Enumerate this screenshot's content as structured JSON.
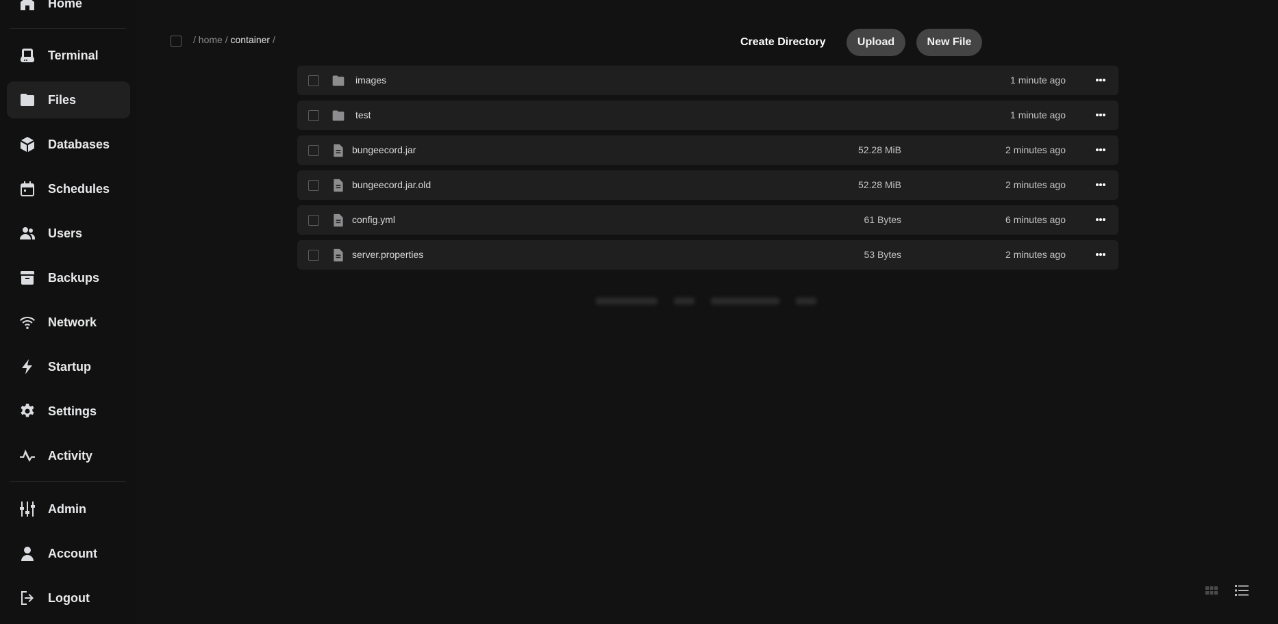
{
  "sidebar": {
    "items": [
      {
        "label": "Home",
        "icon": "home-icon"
      },
      {
        "label": "Terminal",
        "icon": "terminal-icon"
      },
      {
        "label": "Files",
        "icon": "folder-icon",
        "active": true
      },
      {
        "label": "Databases",
        "icon": "database-icon"
      },
      {
        "label": "Schedules",
        "icon": "calendar-icon"
      },
      {
        "label": "Users",
        "icon": "users-icon"
      },
      {
        "label": "Backups",
        "icon": "archive-icon"
      },
      {
        "label": "Network",
        "icon": "wifi-icon"
      },
      {
        "label": "Startup",
        "icon": "bolt-icon"
      },
      {
        "label": "Settings",
        "icon": "gear-icon"
      },
      {
        "label": "Activity",
        "icon": "activity-icon"
      },
      {
        "label": "Admin",
        "icon": "sliders-icon"
      },
      {
        "label": "Account",
        "icon": "user-icon"
      },
      {
        "label": "Logout",
        "icon": "logout-icon"
      }
    ]
  },
  "breadcrumb": {
    "sep": "/",
    "home": "home",
    "container": "container"
  },
  "toolbar": {
    "create_directory": "Create Directory",
    "upload": "Upload",
    "new_file": "New File"
  },
  "files": [
    {
      "name": "images",
      "type": "folder",
      "size": "",
      "modified": "1 minute ago"
    },
    {
      "name": "test",
      "type": "folder",
      "size": "",
      "modified": "1 minute ago"
    },
    {
      "name": "bungeecord.jar",
      "type": "file",
      "size": "52.28 MiB",
      "modified": "2 minutes ago"
    },
    {
      "name": "bungeecord.jar.old",
      "type": "file",
      "size": "52.28 MiB",
      "modified": "2 minutes ago"
    },
    {
      "name": "config.yml",
      "type": "file",
      "size": "61 Bytes",
      "modified": "6 minutes ago"
    },
    {
      "name": "server.properties",
      "type": "file",
      "size": "53 Bytes",
      "modified": "2 minutes ago"
    }
  ],
  "footer": {
    "blurred_note": ""
  },
  "colors": {
    "background": "#121212",
    "row_background": "#1f1f1f",
    "active_nav": "#202021",
    "pill_button": "#444444"
  }
}
